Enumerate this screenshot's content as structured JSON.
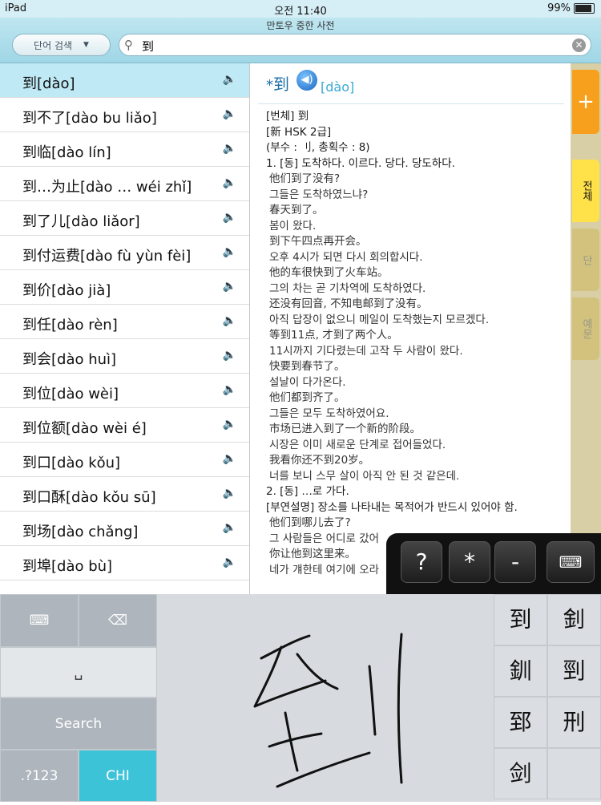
{
  "status_bar": {
    "device": "iPad",
    "time": "오전 11:40",
    "battery": "99%"
  },
  "app": {
    "title": "만토우 중한 사전",
    "mode_label": "단어 검색",
    "search_value": "到"
  },
  "word_list": [
    {
      "text": "到[dào]",
      "selected": true
    },
    {
      "text": "到不了[dào bu liǎo]"
    },
    {
      "text": "到临[dào lín]"
    },
    {
      "text": "到…为止[dào … wéi zhǐ]"
    },
    {
      "text": "到了儿[dào liǎor]"
    },
    {
      "text": "到付运费[dào fù yùn fèi]"
    },
    {
      "text": "到价[dào jià]"
    },
    {
      "text": "到任[dào rèn]"
    },
    {
      "text": "到会[dào huì]"
    },
    {
      "text": "到位[dào wèi]"
    },
    {
      "text": "到位额[dào wèi é]"
    },
    {
      "text": "到口[dào kǒu]"
    },
    {
      "text": "到口酥[dào kǒu sū]"
    },
    {
      "text": "到场[dào chǎng]"
    },
    {
      "text": "到埠[dào bù]"
    }
  ],
  "entry": {
    "star": "*",
    "headword": "到",
    "pinyin": "[dào]",
    "lines": [
      {
        "text": "[번체] 到",
        "cls": "bl"
      },
      {
        "text": "[新 HSK 2급]",
        "cls": "bl"
      },
      {
        "text": "(부수 : 刂, 총획수 : 8)",
        "cls": "bl"
      },
      {
        "text": "1. [동] 도착하다. 이르다. 당다. 당도하다.",
        "cls": "bl"
      },
      {
        "text": "他们到了没有?",
        "cls": "ex"
      },
      {
        "text": "그들은 도착하였느냐?",
        "cls": "ex"
      },
      {
        "text": "春天到了。",
        "cls": "ex"
      },
      {
        "text": "봄이 왔다.",
        "cls": "ex"
      },
      {
        "text": "到下午四点再开会。",
        "cls": "ex"
      },
      {
        "text": "오후 4시가 되면 다시 회의합시다.",
        "cls": "ex"
      },
      {
        "text": "他的车很快到了火车站。",
        "cls": "ex"
      },
      {
        "text": "그의 차는 곧 기차역에 도착하였다.",
        "cls": "ex"
      },
      {
        "text": "还没有回音, 不知电邮到了没有。",
        "cls": "ex"
      },
      {
        "text": "아직 답장이 없으니 메일이 도착했는지 모르겠다.",
        "cls": "ex"
      },
      {
        "text": "等到11点, 才到了两个人。",
        "cls": "ex"
      },
      {
        "text": "11시까지 기다렸는데 고작 두 사람이 왔다.",
        "cls": "ex"
      },
      {
        "text": "快要到春节了。",
        "cls": "ex"
      },
      {
        "text": "설날이 다가온다.",
        "cls": "ex"
      },
      {
        "text": "他们都到齐了。",
        "cls": "ex"
      },
      {
        "text": "그들은 모두 도착하였어요.",
        "cls": "ex"
      },
      {
        "text": "市场已进入到了一个新的阶段。",
        "cls": "ex"
      },
      {
        "text": "시장은 이미 새로운 단계로 접어들었다.",
        "cls": "ex"
      },
      {
        "text": "我看你还不到20岁。",
        "cls": "ex"
      },
      {
        "text": "너를 보니 스무 살이 아직 안 된 것 같은데.",
        "cls": "ex"
      },
      {
        "text": "2. [동] …로 가다.",
        "cls": "bl"
      },
      {
        "text": "[부연설명] 장소를 나타내는 목적어가 반드시 있어야 함.",
        "cls": "bl"
      },
      {
        "text": "他们到哪儿去了?",
        "cls": "ex"
      },
      {
        "text": "그 사람들은 어디로 갔어",
        "cls": "ex"
      },
      {
        "text": "你让他到这里来。",
        "cls": "ex"
      },
      {
        "text": "네가 걔한테 여기에 오라",
        "cls": "ex"
      }
    ]
  },
  "side_tabs": {
    "add": "+",
    "all": "전체",
    "b": "단",
    "c": "예문"
  },
  "float_keys": [
    "?",
    "*",
    "-"
  ],
  "keyboard": {
    "space_label": "␣",
    "search_label": "Search",
    "num_label": ".?123",
    "lang_label": "CHI",
    "candidates": [
      "到",
      "釗",
      "釧",
      "剄",
      "郅",
      "刑",
      "剑"
    ]
  }
}
